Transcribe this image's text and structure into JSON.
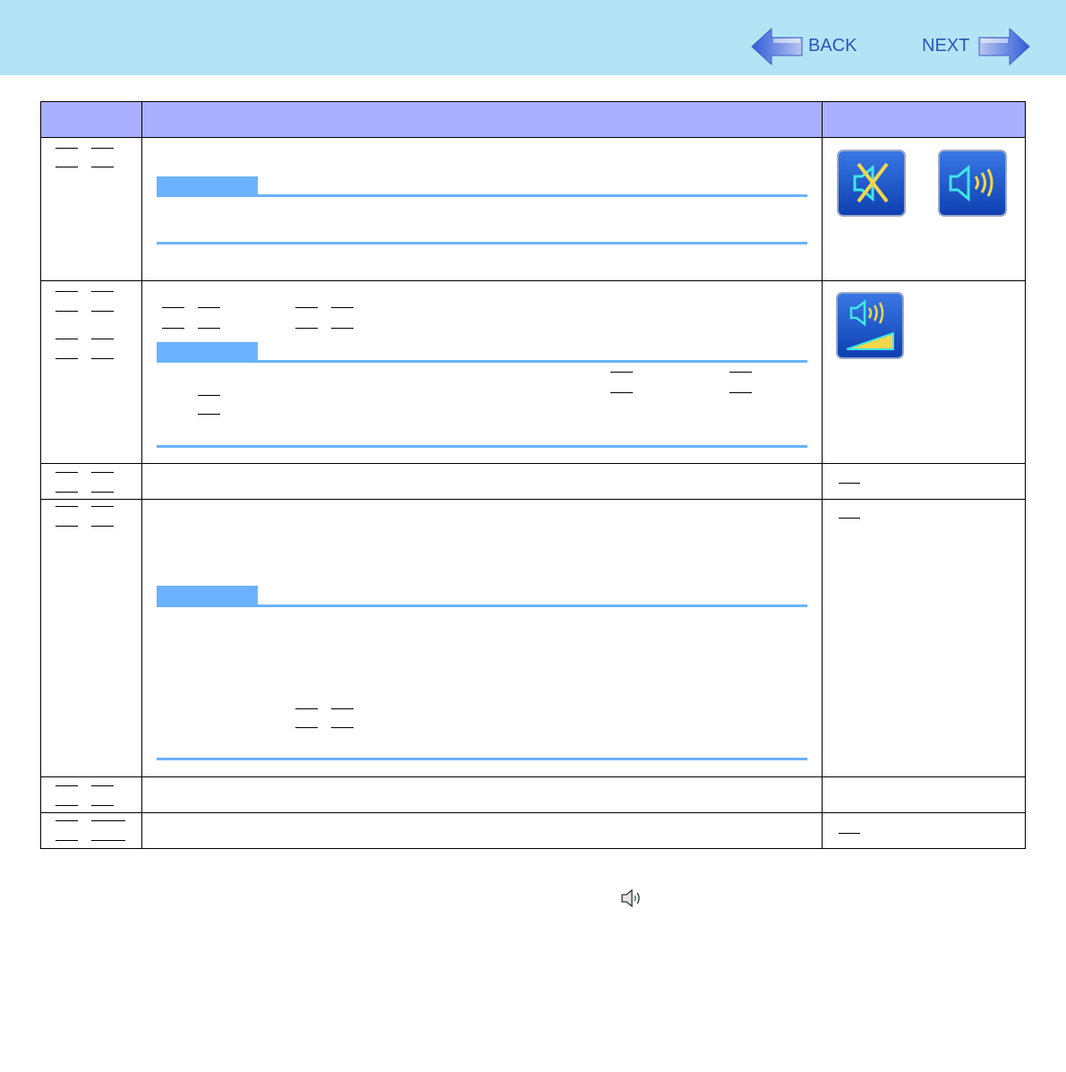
{
  "header": {
    "back_label": "BACK",
    "next_label": "NEXT",
    "accent_color": "#2a56b8",
    "background_color": "#b3e4f6"
  },
  "table": {
    "header_color": "#aab0ff",
    "note_color": "#6ab2ff",
    "rows": [
      {
        "icons": [
          "mute-icon",
          "speaker-on-icon"
        ]
      },
      {
        "icons": [
          "volume-level-icon"
        ]
      },
      {
        "icons": []
      },
      {
        "icons": []
      },
      {
        "icons": []
      },
      {
        "icons": []
      }
    ]
  },
  "footer": {
    "icon": "speaker-icon"
  }
}
